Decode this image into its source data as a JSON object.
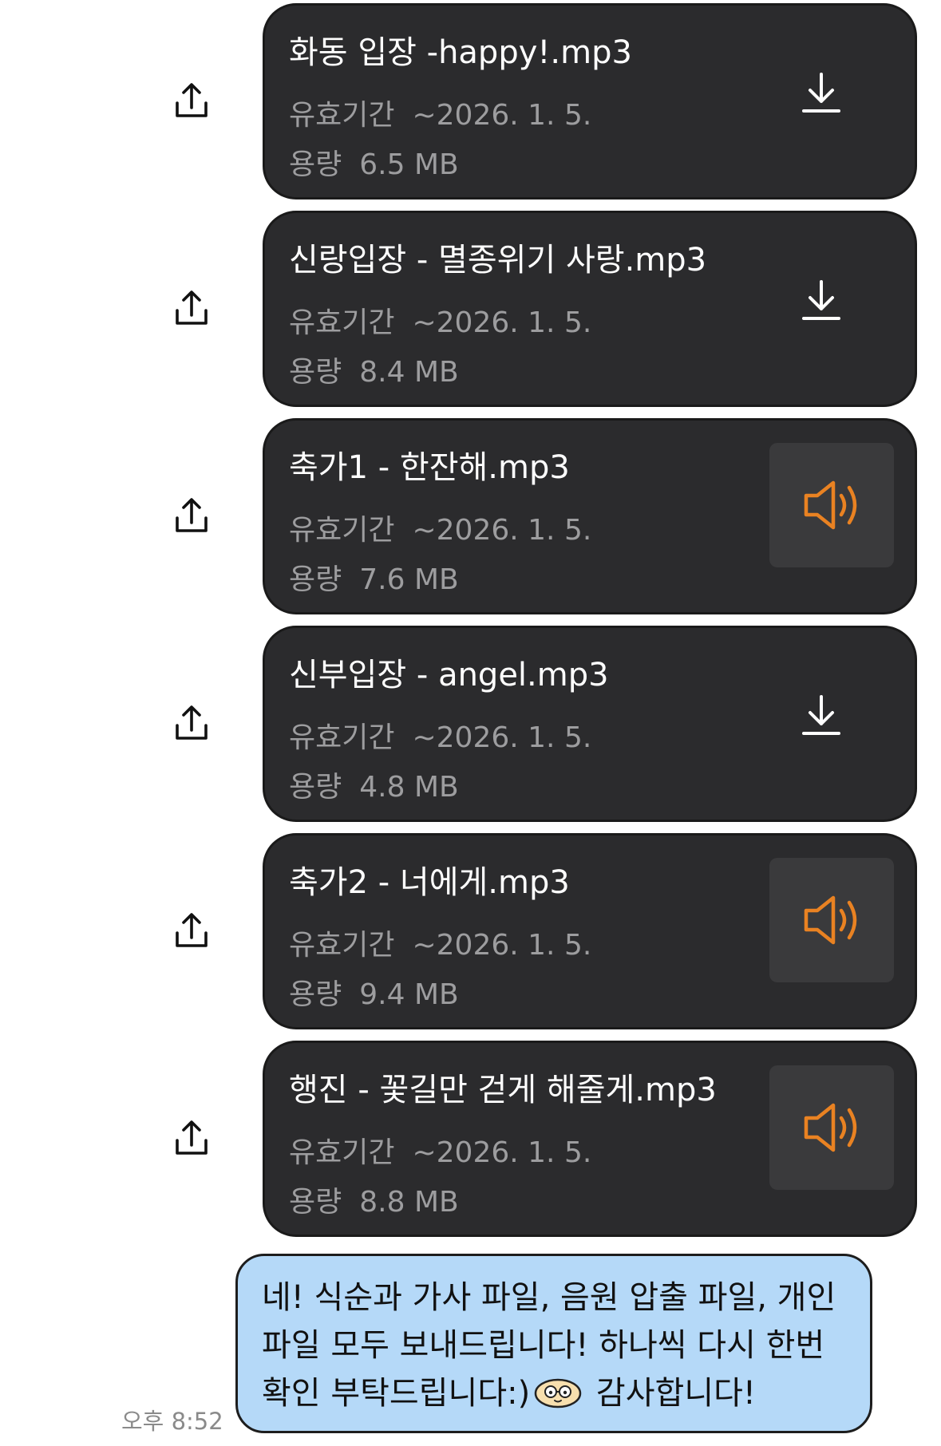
{
  "files": [
    {
      "name": "화동 입장 -happy!.mp3",
      "expiry_label": "유효기간",
      "expiry_value": "~2026. 1. 5.",
      "size_label": "용량",
      "size_value": "6.5 MB",
      "action": "download"
    },
    {
      "name": "신랑입장 - 멸종위기 사랑.mp3",
      "expiry_label": "유효기간",
      "expiry_value": "~2026. 1. 5.",
      "size_label": "용량",
      "size_value": "8.4 MB",
      "action": "download"
    },
    {
      "name": "축가1 - 한잔해.mp3",
      "expiry_label": "유효기간",
      "expiry_value": "~2026. 1. 5.",
      "size_label": "용량",
      "size_value": "7.6 MB",
      "action": "play"
    },
    {
      "name": "신부입장 - angel.mp3",
      "expiry_label": "유효기간",
      "expiry_value": "~2026. 1. 5.",
      "size_label": "용량",
      "size_value": "4.8 MB",
      "action": "download"
    },
    {
      "name": "축가2 - 너에게.mp3",
      "expiry_label": "유효기간",
      "expiry_value": "~2026. 1. 5.",
      "size_label": "용량",
      "size_value": "9.4 MB",
      "action": "play"
    },
    {
      "name": "행진 - 꽃길만 걷게 해줄게.mp3",
      "expiry_label": "유효기간",
      "expiry_value": "~2026. 1. 5.",
      "size_label": "용량",
      "size_value": "8.8 MB",
      "action": "play"
    }
  ],
  "icons": {
    "share": "share-icon",
    "download": "download-icon",
    "play": "speaker-icon"
  },
  "message": {
    "lines": [
      "네! 식순과 가사 파일, 음원 압출 파일, 개인",
      "파일 모두 보내드립니다! 하나씩 다시 한번"
    ],
    "line3_before_emoji": "확인 부탁드립니다:)",
    "line3_after_emoji": " 감사합니다!",
    "emoji_icon": "emoticon-face-icon",
    "time": "오후 8:52"
  },
  "colors": {
    "card_bg": "#2b2b2d",
    "bubble_bg": "#b5d9f8",
    "speaker_accent": "#e98222",
    "meta_text": "#9d9d9f"
  }
}
